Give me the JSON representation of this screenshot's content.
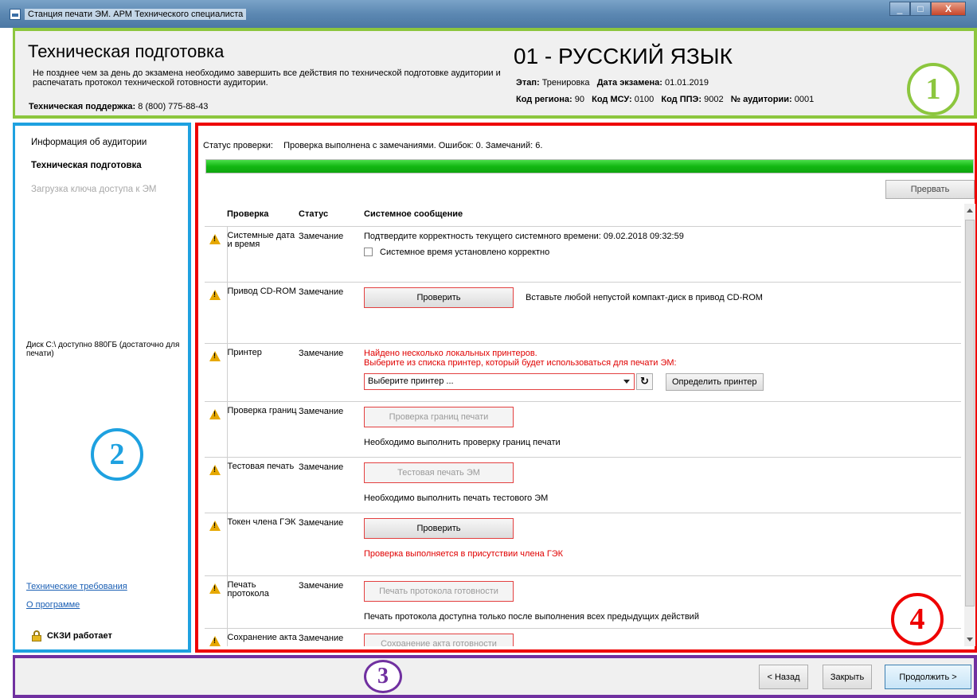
{
  "window": {
    "title": "Станция печати ЭМ. АРМ Технического специалиста",
    "minimize_label": "_",
    "maximize_label": "□",
    "close_label": "X"
  },
  "header": {
    "title": "Техническая подготовка",
    "description": "Не позднее чем за день до экзамена необходимо завершить все действия по технической подготовке аудитории и распечатать протокол технической готовности аудитории.",
    "support_label": "Техническая поддержка:",
    "support_phone": "8 (800) 775-88-43",
    "subject": "01 - РУССКИЙ ЯЗЫК",
    "stage_label": "Этап:",
    "stage_value": "Тренировка",
    "exam_date_label": "Дата экзамена:",
    "exam_date_value": "01.01.2019",
    "region_label": "Код региона:",
    "region_value": "90",
    "msu_label": "Код МСУ:",
    "msu_value": "0100",
    "ppe_label": "Код ППЭ:",
    "ppe_value": "9002",
    "room_label": "№ аудитории:",
    "room_value": "0001"
  },
  "sidebar": {
    "items": [
      {
        "label": "Информация об аудитории"
      },
      {
        "label": "Техническая подготовка"
      },
      {
        "label": "Загрузка ключа доступа к ЭМ"
      }
    ],
    "disk_info": "Диск C:\\ доступно 880ГБ (достаточно для печати)",
    "links": [
      "Технические требования",
      "О программе"
    ],
    "skzi_status": "СКЗИ работает"
  },
  "main": {
    "status_label": "Статус проверки:",
    "status_text": "Проверка выполнена с замечаниями. Ошибок: 0. Замечаний: 6.",
    "progress_fraction": 1.0,
    "abort_label": "Прервать",
    "columns": [
      "Проверка",
      "Статус",
      "Системное сообщение"
    ],
    "rows": [
      {
        "check": "Системные дата и время",
        "status": "Замечание",
        "message": "Подтвердите корректность текущего системного времени: 09.02.2018 09:32:59",
        "checkbox_label": "Системное время установлено корректно"
      },
      {
        "check": "Привод CD-ROM",
        "status": "Замечание",
        "button": "Проверить",
        "hint": "Вставьте любой непустой компакт-диск в привод CD-ROM"
      },
      {
        "check": "Принтер",
        "status": "Замечание",
        "message_line1": "Найдено несколько локальных принтеров.",
        "message_line2": "Выберите из списка принтер, который будет использоваться для печати ЭМ:",
        "select_value": "Выберите принтер ...",
        "refresh_label": "↻",
        "detect_label": "Определить принтер"
      },
      {
        "check": "Проверка границ",
        "status": "Замечание",
        "button": "Проверка границ печати",
        "note": "Необходимо выполнить проверку границ печати"
      },
      {
        "check": "Тестовая печать",
        "status": "Замечание",
        "button": "Тестовая печать ЭМ",
        "note": "Необходимо выполнить печать тестового ЭМ"
      },
      {
        "check": "Токен члена ГЭК",
        "status": "Замечание",
        "button": "Проверить",
        "note": "Проверка выполняется в присутствии члена ГЭК"
      },
      {
        "check": "Печать протокола",
        "status": "Замечание",
        "button": "Печать протокола готовности",
        "note": "Печать протокола доступна только после выполнения всех предыдущих действий"
      },
      {
        "check": "Сохранение акта",
        "status": "Замечание",
        "button": "Сохранение акта готовности"
      }
    ]
  },
  "footer": {
    "back_label": "< Назад",
    "close_label": "Закрыть",
    "next_label": "Продолжить >"
  },
  "annotations": {
    "c1": "1",
    "c2": "2",
    "c3": "3",
    "c4": "4"
  },
  "colors": {
    "header_border": "#8cc63e",
    "sidebar_border": "#1ea1e0",
    "main_border": "#ee0000",
    "footer_border": "#7030a0",
    "progress_fill": "#12b812"
  }
}
